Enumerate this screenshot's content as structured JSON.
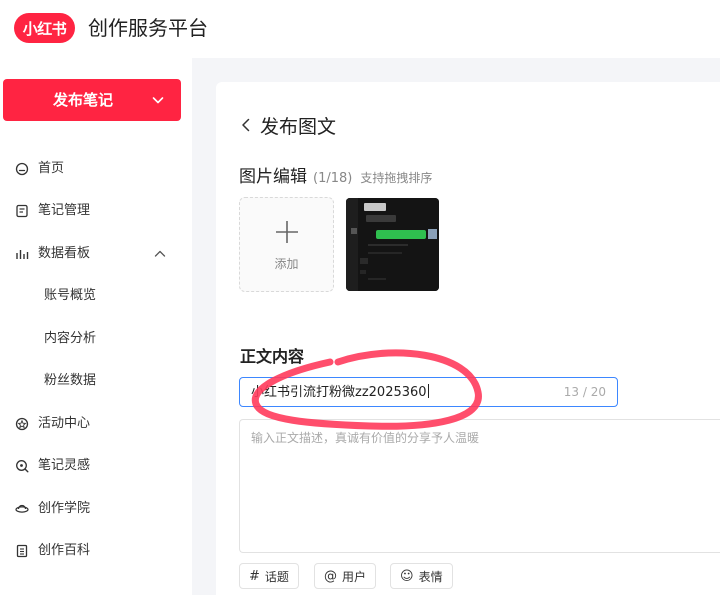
{
  "header": {
    "logo_text": "小红书",
    "app_title": "创作服务平台"
  },
  "sidebar": {
    "publish_label": "发布笔记",
    "items": [
      {
        "label": "首页",
        "icon": "home-icon"
      },
      {
        "label": "笔记管理",
        "icon": "note-icon"
      },
      {
        "label": "数据看板",
        "icon": "chart-icon",
        "expanded": true
      },
      {
        "label": "账号概览",
        "sub": true
      },
      {
        "label": "内容分析",
        "sub": true
      },
      {
        "label": "粉丝数据",
        "sub": true
      },
      {
        "label": "活动中心",
        "icon": "activity-icon"
      },
      {
        "label": "笔记灵感",
        "icon": "inspiration-icon"
      },
      {
        "label": "创作学院",
        "icon": "academy-icon"
      },
      {
        "label": "创作百科",
        "icon": "wiki-icon"
      }
    ]
  },
  "editor": {
    "back_title": "发布图文",
    "image_edit": {
      "title": "图片编辑",
      "count": "(1/18)",
      "hint": "支持拖拽排序",
      "add_label": "添加"
    },
    "body_title": "正文内容",
    "title_input": {
      "value": "小红书引流打粉微zz2025360",
      "counter": "13 / 20"
    },
    "description": {
      "placeholder": "输入正文描述，真诚有价值的分享予人温暖"
    },
    "tools": [
      {
        "symbol": "#",
        "label": "话题",
        "icon": "hashtag-icon"
      },
      {
        "symbol": "@",
        "label": "用户",
        "icon": "at-icon"
      },
      {
        "symbol": "☺",
        "label": "表情",
        "icon": "emoji-icon"
      }
    ]
  },
  "colors": {
    "brand": "#ff2442",
    "focus": "#3d87ff",
    "annotation": "#ff3b5c"
  }
}
